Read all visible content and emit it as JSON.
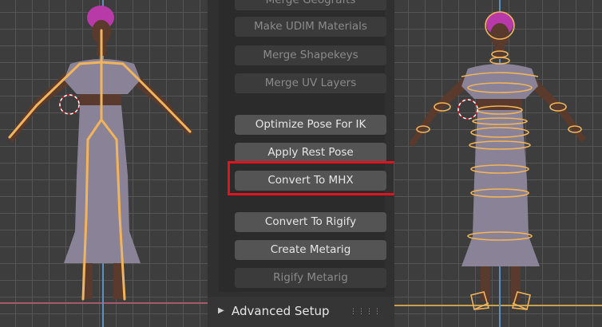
{
  "panel": {
    "buttons": [
      {
        "label": "Merge Geografts",
        "enabled": false
      },
      {
        "label": "Make UDIM Materials",
        "enabled": false
      },
      {
        "label": "Merge Shapekeys",
        "enabled": false
      },
      {
        "label": "Merge UV Layers",
        "enabled": false
      },
      {
        "label": "Optimize Pose For IK",
        "enabled": true
      },
      {
        "label": "Apply Rest Pose",
        "enabled": true
      },
      {
        "label": "Convert To MHX",
        "enabled": true
      },
      {
        "label": "Convert To Rigify",
        "enabled": true
      },
      {
        "label": "Create Metarig",
        "enabled": true
      },
      {
        "label": "Rigify Metarig",
        "enabled": false
      }
    ],
    "highlighted_button": "Convert To MHX",
    "advanced_section": {
      "label": "Advanced Setup",
      "expanded": false,
      "arrow_icon": "disclosure-triangle-right-icon",
      "grip_icon": "drag-grip-icon"
    }
  },
  "colors": {
    "highlight": "#e0141e",
    "bone": "#f2b45a",
    "dress": "#8a8296",
    "hair": "#b83aa8"
  }
}
